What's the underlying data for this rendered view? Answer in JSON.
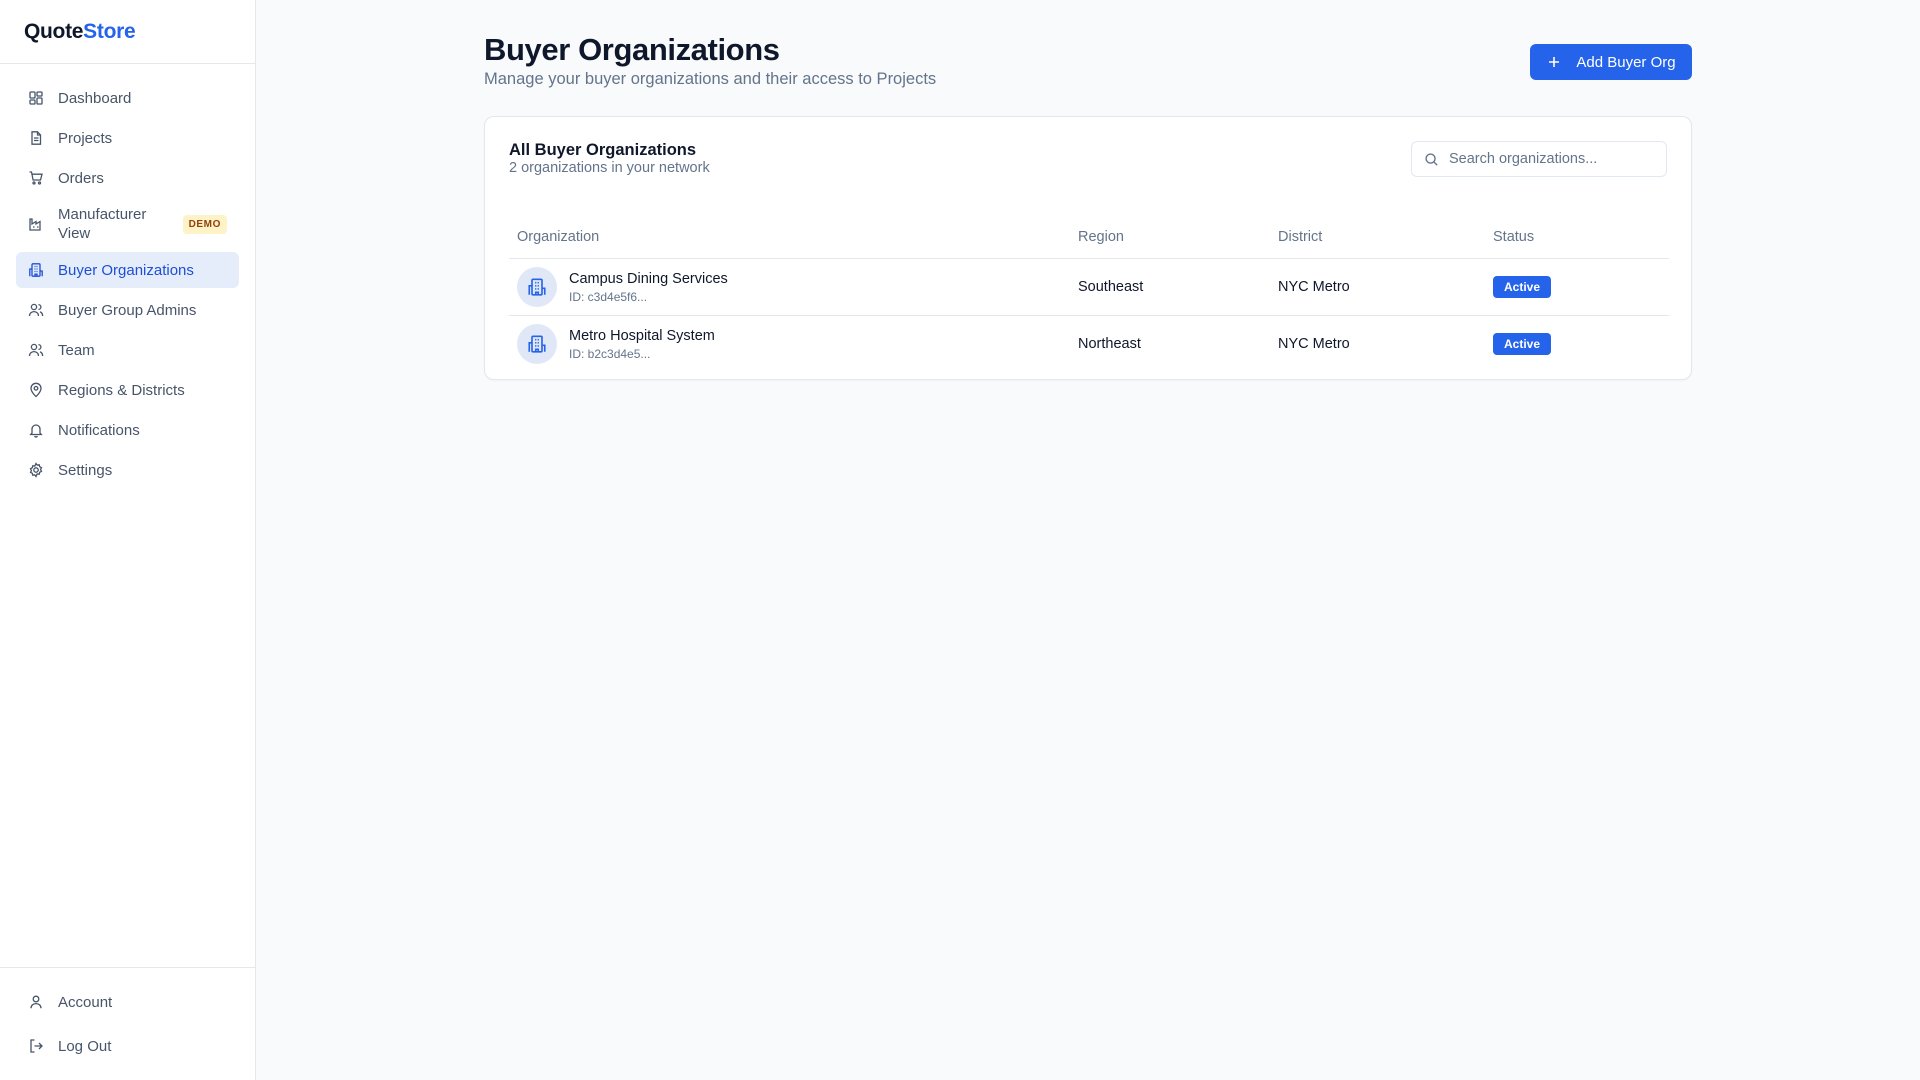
{
  "brand": {
    "part1": "Quote",
    "part2": "Store"
  },
  "sidebar": {
    "items": [
      {
        "label": "Dashboard",
        "icon": "dashboard-icon"
      },
      {
        "label": "Projects",
        "icon": "document-icon"
      },
      {
        "label": "Orders",
        "icon": "cart-icon"
      },
      {
        "label": "Manufacturer View",
        "icon": "factory-icon",
        "badge": "DEMO"
      },
      {
        "label": "Buyer Organizations",
        "icon": "building-icon",
        "active": true
      },
      {
        "label": "Buyer Group Admins",
        "icon": "users-icon"
      },
      {
        "label": "Team",
        "icon": "team-icon"
      },
      {
        "label": "Regions & Districts",
        "icon": "map-pin-icon"
      },
      {
        "label": "Notifications",
        "icon": "bell-icon"
      },
      {
        "label": "Settings",
        "icon": "gear-icon"
      }
    ],
    "bottom": [
      {
        "label": "Account",
        "icon": "user-icon"
      },
      {
        "label": "Log Out",
        "icon": "logout-icon"
      }
    ]
  },
  "page": {
    "title": "Buyer Organizations",
    "subtitle": "Manage your buyer organizations and their access to Projects",
    "add_button": "Add Buyer Org"
  },
  "card": {
    "title": "All Buyer Organizations",
    "subtitle": "2 organizations in your network",
    "search_placeholder": "Search organizations..."
  },
  "table": {
    "headers": [
      "Organization",
      "Region",
      "District",
      "Status"
    ],
    "rows": [
      {
        "name": "Campus Dining Services",
        "id": "ID: c3d4e5f6...",
        "region": "Southeast",
        "district": "NYC Metro",
        "status": "Active"
      },
      {
        "name": "Metro Hospital System",
        "id": "ID: b2c3d4e5...",
        "region": "Northeast",
        "district": "NYC Metro",
        "status": "Active"
      }
    ]
  },
  "colors": {
    "accent": "#2563eb",
    "active_bg": "#e5edfb",
    "demo_bg": "#fef3c7",
    "demo_text": "#92400e"
  }
}
